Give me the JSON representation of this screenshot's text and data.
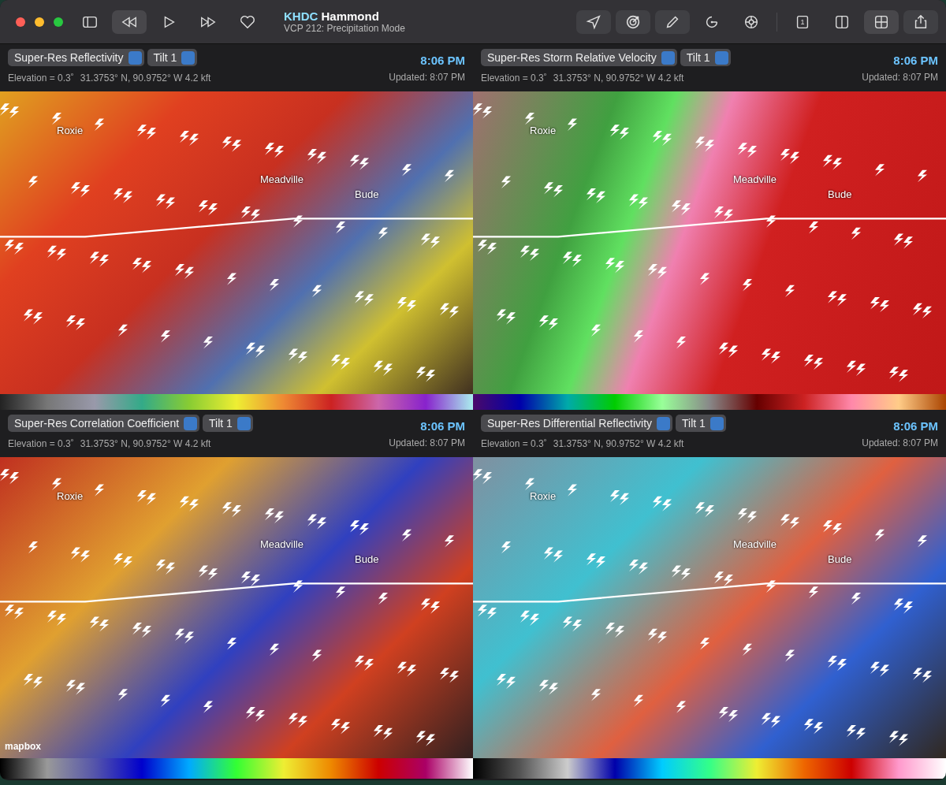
{
  "window": {
    "station_code": "KHDC",
    "station_name": "Hammond",
    "subtitle": "VCP 212: Precipitation Mode"
  },
  "playback": [
    {
      "kind": "sidebar",
      "selected": false
    },
    {
      "kind": "rewind",
      "selected": true
    },
    {
      "kind": "play",
      "selected": false
    },
    {
      "kind": "forward",
      "selected": false
    },
    {
      "kind": "favorite",
      "selected": false
    }
  ],
  "tools": [
    {
      "kind": "locate"
    },
    {
      "kind": "radar"
    },
    {
      "kind": "pencil"
    },
    {
      "kind": "timer"
    },
    {
      "kind": "target"
    }
  ],
  "layouts": [
    {
      "kind": "single",
      "label": "1",
      "selected": false
    },
    {
      "kind": "split",
      "selected": false
    },
    {
      "kind": "quad",
      "selected": true
    }
  ],
  "panels": [
    {
      "product": "Super-Res Reflectivity",
      "kind": "reflectivity",
      "tilt": "Tilt 1",
      "time": "8:06 PM",
      "elevation": "Elevation = 0.3˚",
      "coords": "31.3753° N, 90.9752° W 4.2 kft",
      "updated": "Updated: 8:07 PM",
      "places": [
        "Roxie",
        "Meadville",
        "Bude"
      ]
    },
    {
      "product": "Super-Res Storm Relative Velocity",
      "kind": "velocity",
      "tilt": "Tilt 1",
      "time": "8:06 PM",
      "elevation": "Elevation = 0.3˚",
      "coords": "31.3753° N, 90.9752° W 4.2 kft",
      "updated": "Updated: 8:07 PM",
      "places": [
        "Roxie",
        "Meadville",
        "Bude"
      ]
    },
    {
      "product": "Super-Res Correlation Coefficient",
      "kind": "correlation",
      "tilt": "Tilt 1",
      "time": "8:06 PM",
      "elevation": "Elevation = 0.3˚",
      "coords": "31.3753° N, 90.9752° W 4.2 kft",
      "updated": "Updated: 8:07 PM",
      "places": [
        "Roxie",
        "Meadville",
        "Bude"
      ],
      "attribution": "mapbox"
    },
    {
      "product": "Super-Res Differential Reflectivity",
      "kind": "differential",
      "tilt": "Tilt 1",
      "time": "8:06 PM",
      "elevation": "Elevation = 0.3˚",
      "coords": "31.3753° N, 90.9752° W 4.2 kft",
      "updated": "Updated: 8:07 PM",
      "places": [
        "Roxie",
        "Meadville",
        "Bude"
      ]
    }
  ]
}
